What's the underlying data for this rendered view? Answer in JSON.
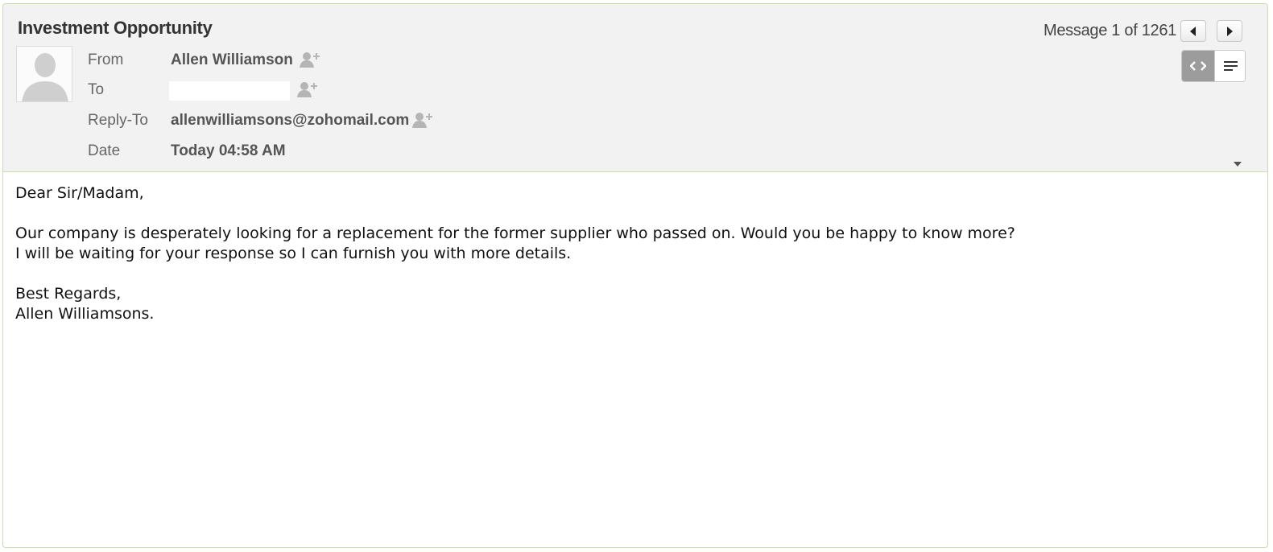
{
  "subject": "Investment Opportunity",
  "navigation": {
    "counter": "Message 1 of 1261"
  },
  "fields": {
    "from_label": "From",
    "from_value": "Allen Williamson",
    "to_label": "To",
    "to_value": "",
    "replyto_label": "Reply-To",
    "replyto_value": "allenwilliamsons@zohomail.com",
    "date_label": "Date",
    "date_value": "Today 04:58 AM"
  },
  "body": {
    "greeting": "Dear Sir/Madam,",
    "line1": "Our company is desperately looking for a replacement for the former supplier who passed on. Would you be happy to know more?",
    "line2": "I will be waiting for your response so I can furnish you with more details.",
    "signoff": "Best Regards,",
    "signature": "Allen Williamsons."
  },
  "icons": {
    "avatar": "default-contact-avatar-icon",
    "add_contact": "add-contact-icon",
    "prev": "caret-left-icon",
    "next": "caret-right-icon",
    "html_view": "code-brackets-icon",
    "text_view": "text-lines-icon",
    "expand": "chevron-down-icon"
  },
  "colors": {
    "header_bg": "#f2f2f2",
    "border": "#c9dcae",
    "toggle_active": "#9c9c9c"
  }
}
